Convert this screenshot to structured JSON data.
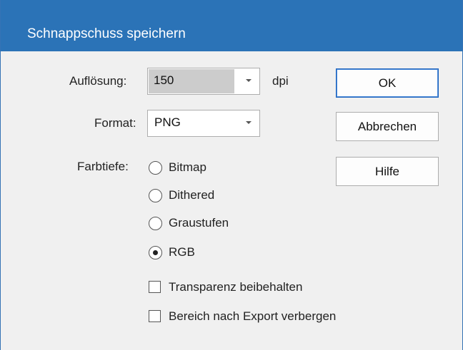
{
  "dialog": {
    "title": "Schnappschuss speichern"
  },
  "resolution": {
    "label": "Auflösung:",
    "value": "150",
    "unit": "dpi"
  },
  "format": {
    "label": "Format:",
    "value": "PNG"
  },
  "color_depth": {
    "label": "Farbtiefe:",
    "options": [
      {
        "label": "Bitmap",
        "selected": false
      },
      {
        "label": "Dithered",
        "selected": false
      },
      {
        "label": "Graustufen",
        "selected": false
      },
      {
        "label": "RGB",
        "selected": true
      }
    ]
  },
  "checkboxes": [
    {
      "label": "Transparenz beibehalten",
      "checked": false
    },
    {
      "label": "Bereich nach Export verbergen",
      "checked": false
    }
  ],
  "buttons": {
    "ok": "OK",
    "cancel": "Abbrechen",
    "help": "Hilfe"
  },
  "colors": {
    "titlebar": "#2b73b7",
    "accent_border": "#1e64be"
  },
  "icons": {
    "dropdown": "chevron-down-icon"
  }
}
